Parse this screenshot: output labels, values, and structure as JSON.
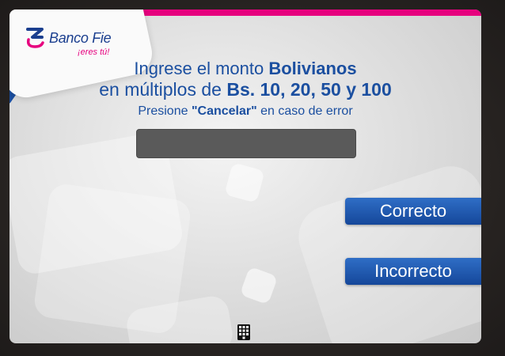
{
  "brand": {
    "name": "Banco Fie",
    "tagline": "¡eres tú!",
    "accent_color": "#e6007e",
    "primary_color": "#1b4fa0"
  },
  "instructions": {
    "line1_prefix": "Ingrese el monto ",
    "line1_emphasis": "Bolivianos",
    "line2_prefix": "en múltiplos de ",
    "line2_emphasis": "Bs. 10, 20, 50 y 100",
    "line3_prefix": "Presione ",
    "line3_emphasis": "\"Cancelar\"",
    "line3_suffix": " en caso de error"
  },
  "amount": {
    "value": ""
  },
  "options": {
    "correct_label": "Correcto",
    "incorrect_label": "Incorrecto"
  },
  "icons": {
    "keypad": "keypad-icon"
  }
}
